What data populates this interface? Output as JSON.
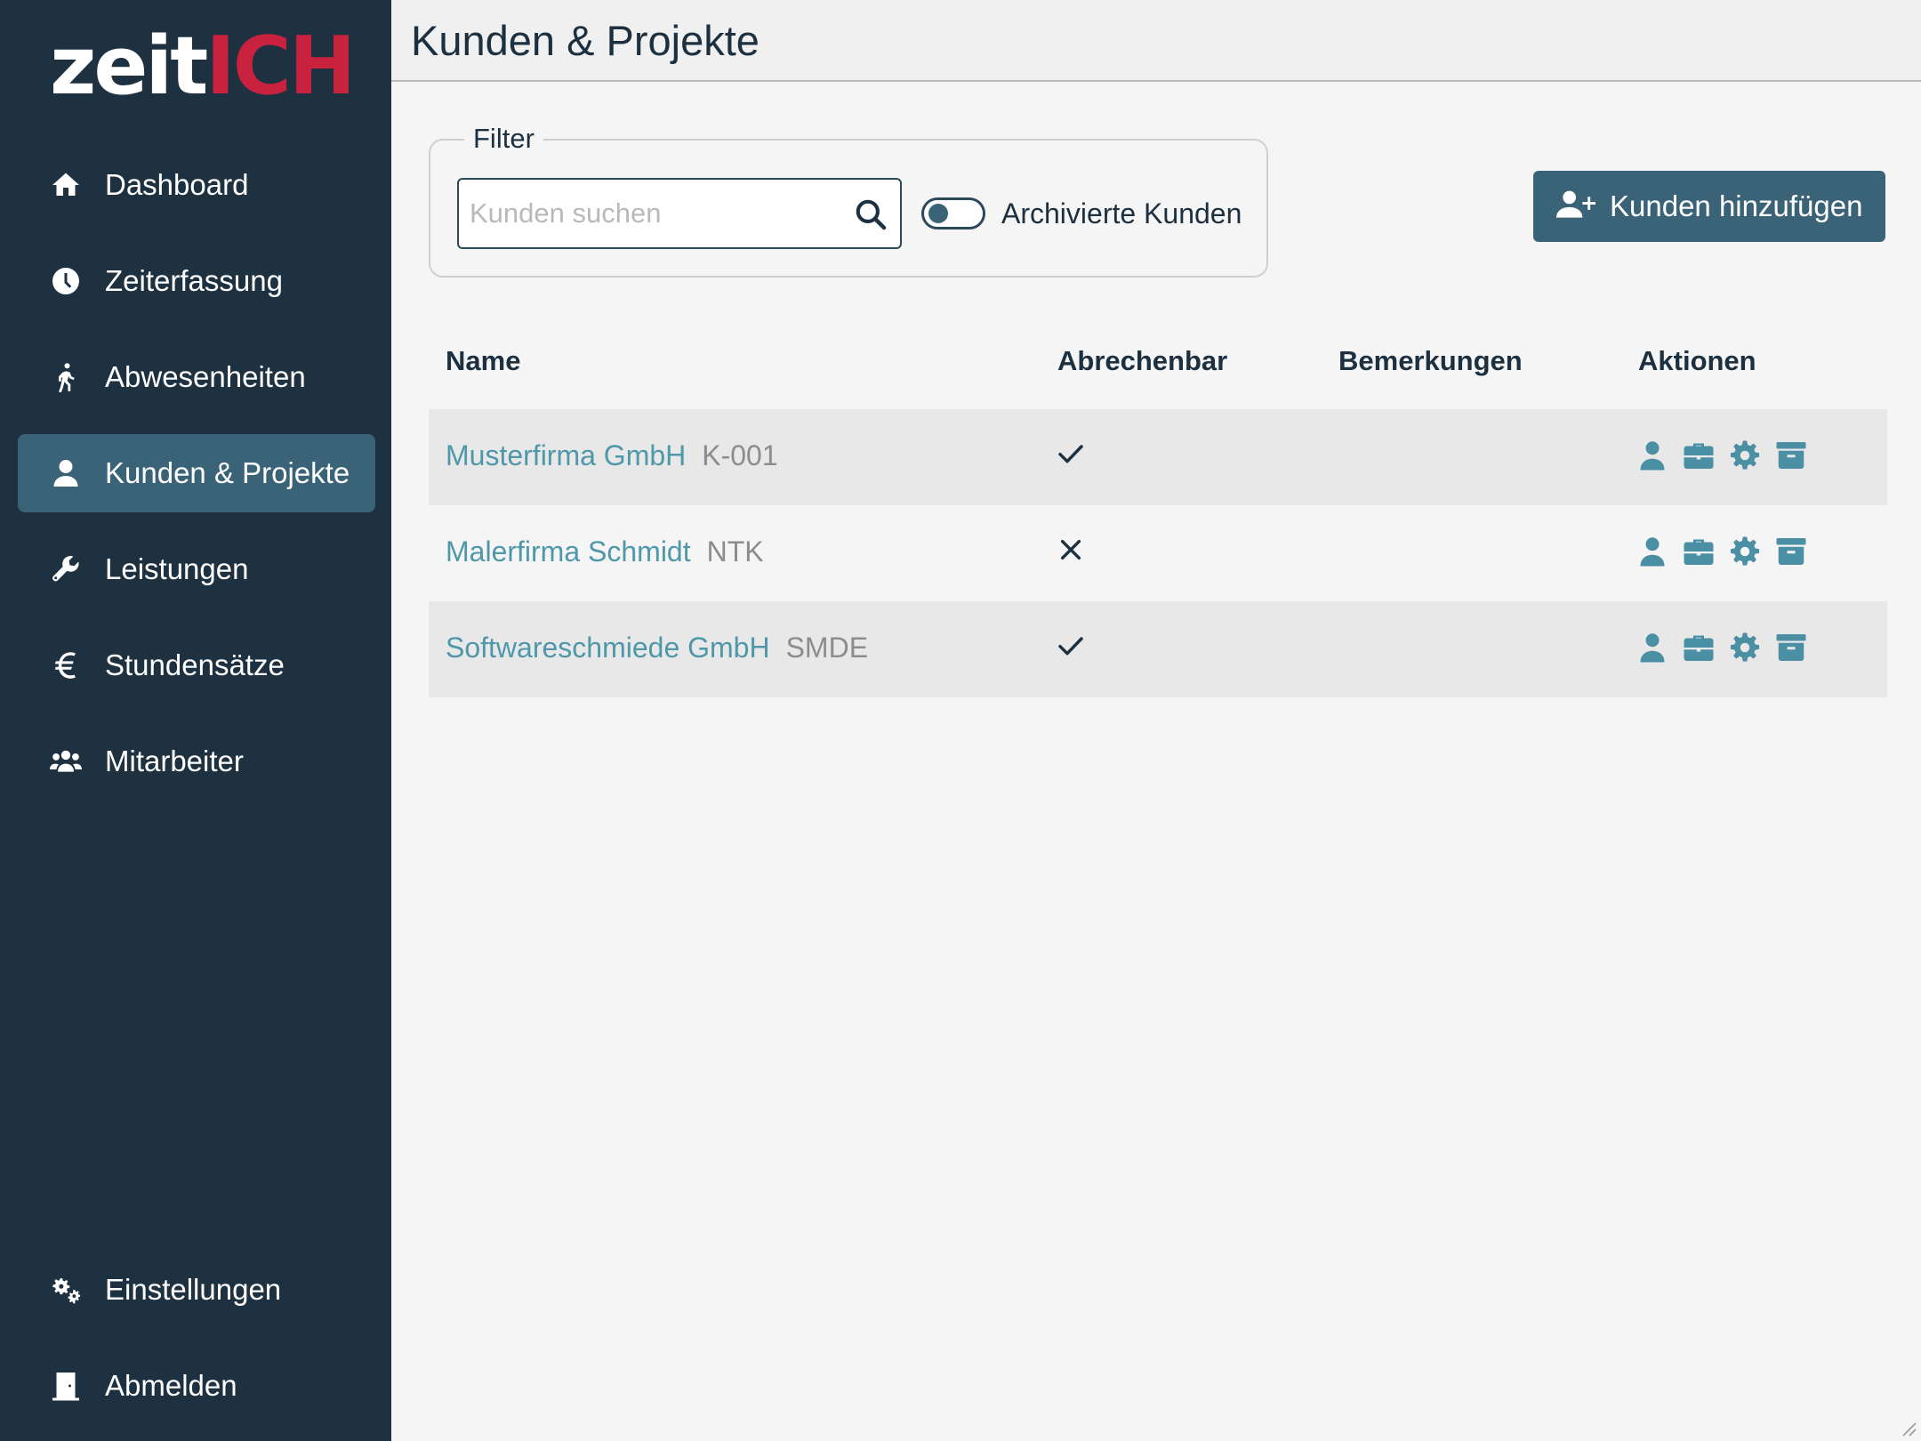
{
  "brand": {
    "logo_part1": "zeit",
    "logo_part2": "ICH"
  },
  "sidebar": {
    "items": [
      {
        "label": "Dashboard",
        "icon": "home-icon"
      },
      {
        "label": "Zeiterfassung",
        "icon": "clock-icon"
      },
      {
        "label": "Abwesenheiten",
        "icon": "walking-icon"
      },
      {
        "label": "Kunden & Projekte",
        "icon": "user-icon",
        "active": true
      },
      {
        "label": "Leistungen",
        "icon": "wrench-icon"
      },
      {
        "label": "Stundensätze",
        "icon": "euro-icon"
      },
      {
        "label": "Mitarbeiter",
        "icon": "users-icon"
      }
    ],
    "bottom_items": [
      {
        "label": "Einstellungen",
        "icon": "gears-icon"
      },
      {
        "label": "Abmelden",
        "icon": "door-icon"
      }
    ]
  },
  "header": {
    "title": "Kunden & Projekte"
  },
  "filter": {
    "legend": "Filter",
    "search_placeholder": "Kunden suchen",
    "search_value": "",
    "archived_label": "Archivierte Kunden",
    "archived_on": false
  },
  "add_button": {
    "label": "Kunden hinzufügen",
    "icon": "user-plus-icon"
  },
  "table": {
    "columns": [
      "Name",
      "Abrechenbar",
      "Bemerkungen",
      "Aktionen"
    ],
    "rows": [
      {
        "name": "Musterfirma GmbH",
        "code": "K-001",
        "billable": true,
        "remarks": ""
      },
      {
        "name": "Malerfirma Schmidt",
        "code": "NTK",
        "billable": false,
        "remarks": ""
      },
      {
        "name": "Softwareschmiede GmbH",
        "code": "SMDE",
        "billable": true,
        "remarks": ""
      }
    ],
    "action_icons": [
      "user-icon",
      "briefcase-icon",
      "gear-icon",
      "archive-icon"
    ]
  },
  "colors": {
    "sidebar_bg": "#1d3141",
    "active_bg": "#3a6377",
    "accent": "#4f98aa",
    "logo_red": "#c8223f"
  }
}
